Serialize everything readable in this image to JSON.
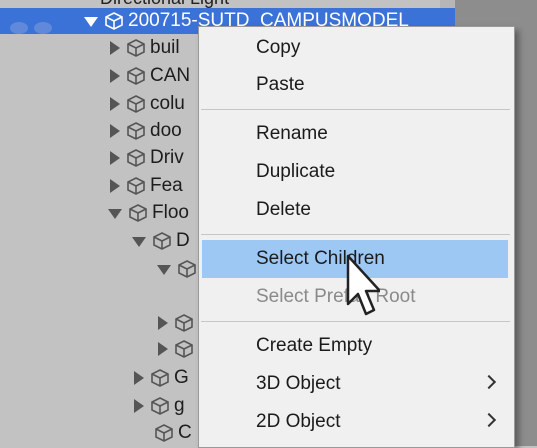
{
  "hierarchy": {
    "partial_top": "Directional Light",
    "selected": "200715-SUTD_CAMPUSMODEL",
    "items": [
      {
        "label": "buil",
        "expanded": false
      },
      {
        "label": "CAN",
        "expanded": false
      },
      {
        "label": "colu",
        "expanded": false
      },
      {
        "label": "doo",
        "expanded": false
      },
      {
        "label": "Driv",
        "expanded": false
      },
      {
        "label": "Fea",
        "expanded": false
      },
      {
        "label": "Floo",
        "expanded": true
      },
      {
        "label": "D",
        "expanded": true
      },
      {
        "label": "",
        "expanded": true
      },
      {
        "label": "",
        "expanded": false
      },
      {
        "label": "",
        "expanded": false
      },
      {
        "label": "G",
        "expanded": false
      },
      {
        "label": "g",
        "expanded": false
      },
      {
        "label": "C",
        "expanded": false
      }
    ]
  },
  "menu": {
    "items": [
      {
        "label": "Copy",
        "enabled": true
      },
      {
        "label": "Paste",
        "enabled": true
      },
      {
        "label": "Rename",
        "enabled": true
      },
      {
        "label": "Duplicate",
        "enabled": true
      },
      {
        "label": "Delete",
        "enabled": true
      },
      {
        "label": "Select Children",
        "enabled": true,
        "highlighted": true
      },
      {
        "label": "Select Prefab Root",
        "enabled": false
      },
      {
        "label": "Create Empty",
        "enabled": true
      },
      {
        "label": "3D Object",
        "enabled": true,
        "submenu": true
      },
      {
        "label": "2D Object",
        "enabled": true,
        "submenu": true
      }
    ]
  },
  "colors": {
    "selection": "#3a72d8",
    "menu_highlight": "#9dc8f4",
    "menu_bg": "#f0f0f0"
  }
}
